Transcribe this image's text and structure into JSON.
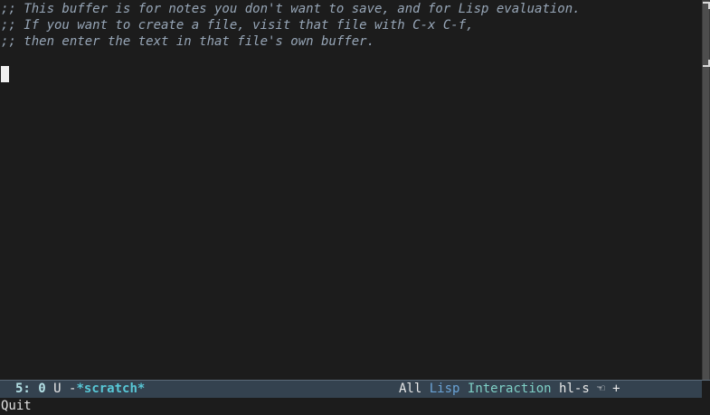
{
  "buffer": {
    "lines": [
      ";; This buffer is for notes you don't want to save, and for Lisp evaluation.",
      ";; If you want to create a file, visit that file with C-x C-f,",
      ";; then enter the text in that file's own buffer."
    ]
  },
  "modeline": {
    "position": "5: 0",
    "state": "U",
    "separator": "-",
    "buffer_name": "*scratch*",
    "extent": "All",
    "major_mode_1": "Lisp",
    "major_mode_2": "Interaction",
    "minor_mode": "hl-s",
    "minor_icon": "☜",
    "plus": "+"
  },
  "minibuffer": {
    "message": "Quit"
  },
  "colors": {
    "background": "#1c1c1c",
    "comment": "#97a6b7",
    "modeline_bg": "#34424f"
  }
}
